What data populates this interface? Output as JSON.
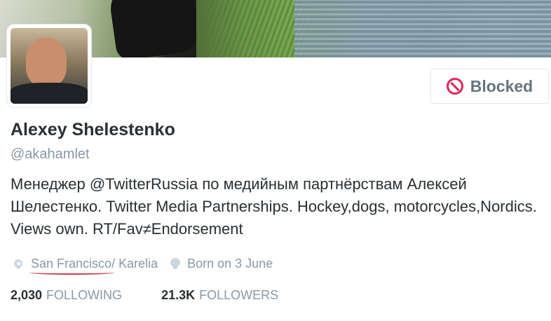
{
  "profile": {
    "name": "Alexey Shelestenko",
    "handle": "@akahamlet",
    "bio": "Менеджер @TwitterRussia по медийным партнёрствам Алексей Шелестенко. Twitter Media Partnerships. Hockey,dogs, motorcycles,Nordics. Views own. RT/Fav≠Endorsement",
    "location_primary": "San Francisco",
    "location_rest": " / Karelia",
    "birthday": "Born on 3 June"
  },
  "actions": {
    "blocked_label": "Blocked",
    "blocked_icon": "block-icon"
  },
  "stats": {
    "following_count": "2,030",
    "following_label": "FOLLOWING",
    "followers_count": "21.3K",
    "followers_label": "FOLLOWERS"
  },
  "colors": {
    "blocked_accent": "#e0245e",
    "muted_text": "#8899a6",
    "annotation_underline": "#d9344a"
  }
}
